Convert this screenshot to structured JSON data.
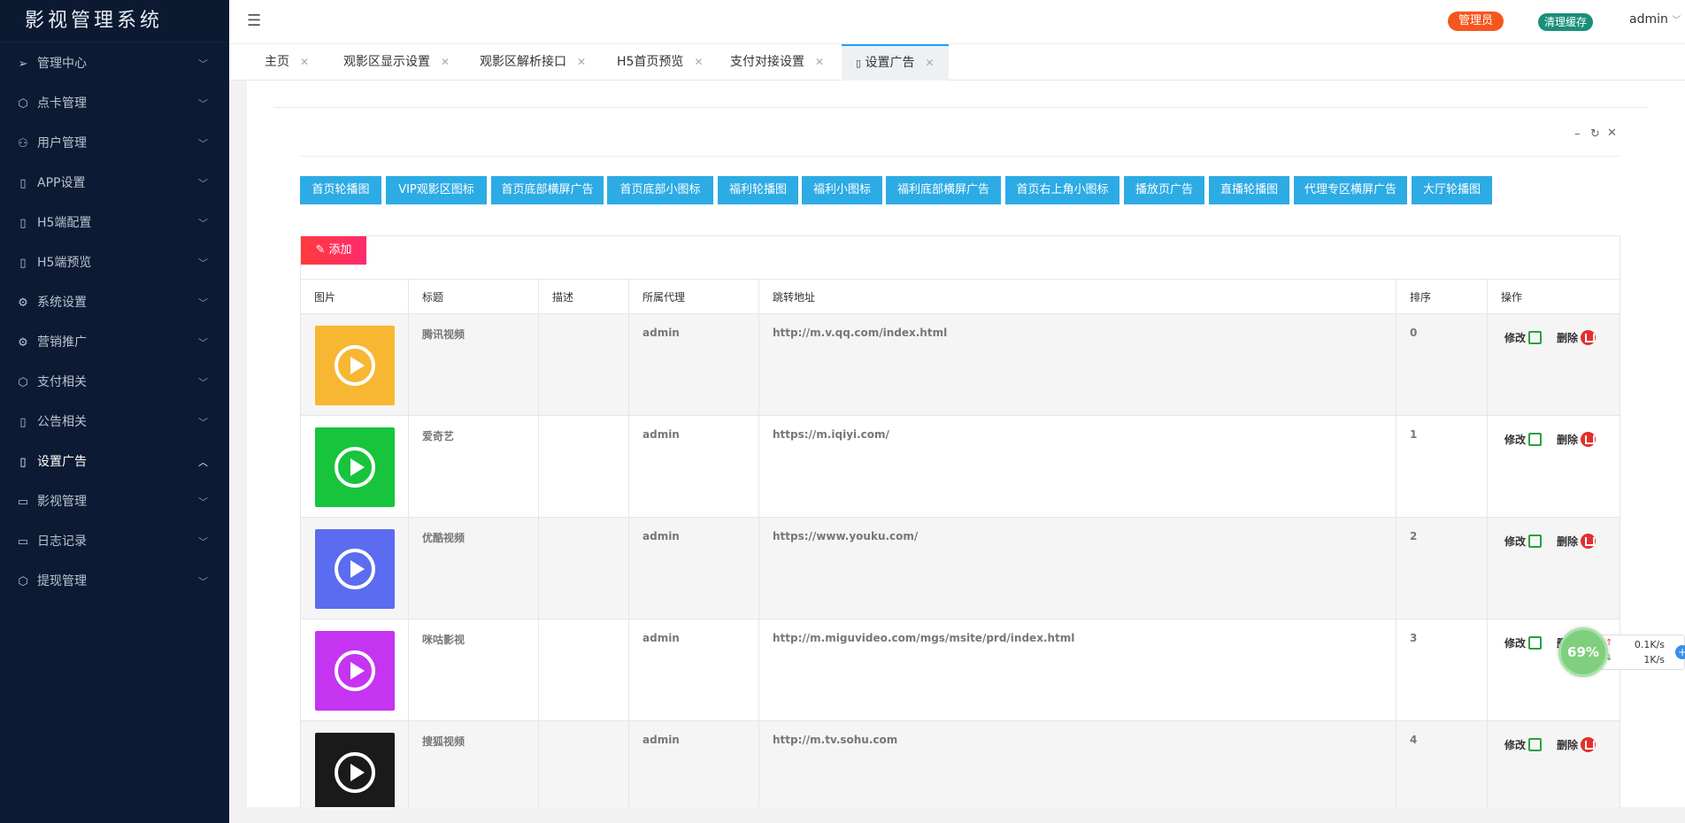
{
  "app": {
    "title": "影视管理系统"
  },
  "sidebar": {
    "items": [
      {
        "label": "管理中心",
        "icon": "send-icon"
      },
      {
        "label": "点卡管理",
        "icon": "cube-icon"
      },
      {
        "label": "用户管理",
        "icon": "user-icon"
      },
      {
        "label": "APP设置",
        "icon": "tablet-icon"
      },
      {
        "label": "H5端配置",
        "icon": "tablet-icon"
      },
      {
        "label": "H5端预览",
        "icon": "tablet-icon"
      },
      {
        "label": "系统设置",
        "icon": "gear-icon"
      },
      {
        "label": "营销推广",
        "icon": "gear-icon"
      },
      {
        "label": "支付相关",
        "icon": "cube-icon"
      },
      {
        "label": "公告相关",
        "icon": "tablet-icon"
      },
      {
        "label": "设置广告",
        "icon": "tablet-icon"
      },
      {
        "label": "影视管理",
        "icon": "video-icon"
      },
      {
        "label": "日志记录",
        "icon": "video-icon"
      },
      {
        "label": "提现管理",
        "icon": "cube-icon"
      }
    ]
  },
  "header": {
    "role_badge": "管理员",
    "clear_cache": "清理缓存",
    "user": "admin"
  },
  "tabs": [
    {
      "label": "主页"
    },
    {
      "label": "观影区显示设置"
    },
    {
      "label": "观影区解析接口"
    },
    {
      "label": "H5首页预览"
    },
    {
      "label": "支付对接设置"
    },
    {
      "label": "设置广告"
    }
  ],
  "categories": [
    "首页轮播图",
    "VIP观影区图标",
    "首页底部横屏广告",
    "首页底部小图标",
    "福利轮播图",
    "福利小图标",
    "福利底部横屏广告",
    "首页右上角小图标",
    "播放页广告",
    "直播轮播图",
    "代理专区横屏广告",
    "大厅轮播图"
  ],
  "toolbar": {
    "add_label": "添加"
  },
  "table": {
    "headers": [
      "图片",
      "标题",
      "描述",
      "所属代理",
      "跳转地址",
      "排序",
      "操作"
    ],
    "rows": [
      {
        "title": "腾讯视频",
        "desc": "",
        "agent": "admin",
        "url": "http://m.v.qq.com/index.html",
        "sort": "0",
        "thumb_color": "#f7b733"
      },
      {
        "title": "爱奇艺",
        "desc": "",
        "agent": "admin",
        "url": "https://m.iqiyi.com/",
        "sort": "1",
        "thumb_color": "#17c43b"
      },
      {
        "title": "优酷视频",
        "desc": "",
        "agent": "admin",
        "url": "https://www.youku.com/",
        "sort": "2",
        "thumb_color": "#5b6cf0"
      },
      {
        "title": "咪咕影视",
        "desc": "",
        "agent": "admin",
        "url": "http://m.miguvideo.com/mgs/msite/prd/index.html",
        "sort": "3",
        "thumb_color": "#c534f0"
      },
      {
        "title": "搜狐视频",
        "desc": "",
        "agent": "admin",
        "url": "http://m.tv.sohu.com",
        "sort": "4",
        "thumb_color": "#1a1a1a"
      }
    ],
    "edit_label": "修改",
    "delete_label": "删除"
  },
  "net_monitor": {
    "percent": "69%",
    "up": "0.1K/s",
    "down": "1K/s"
  }
}
